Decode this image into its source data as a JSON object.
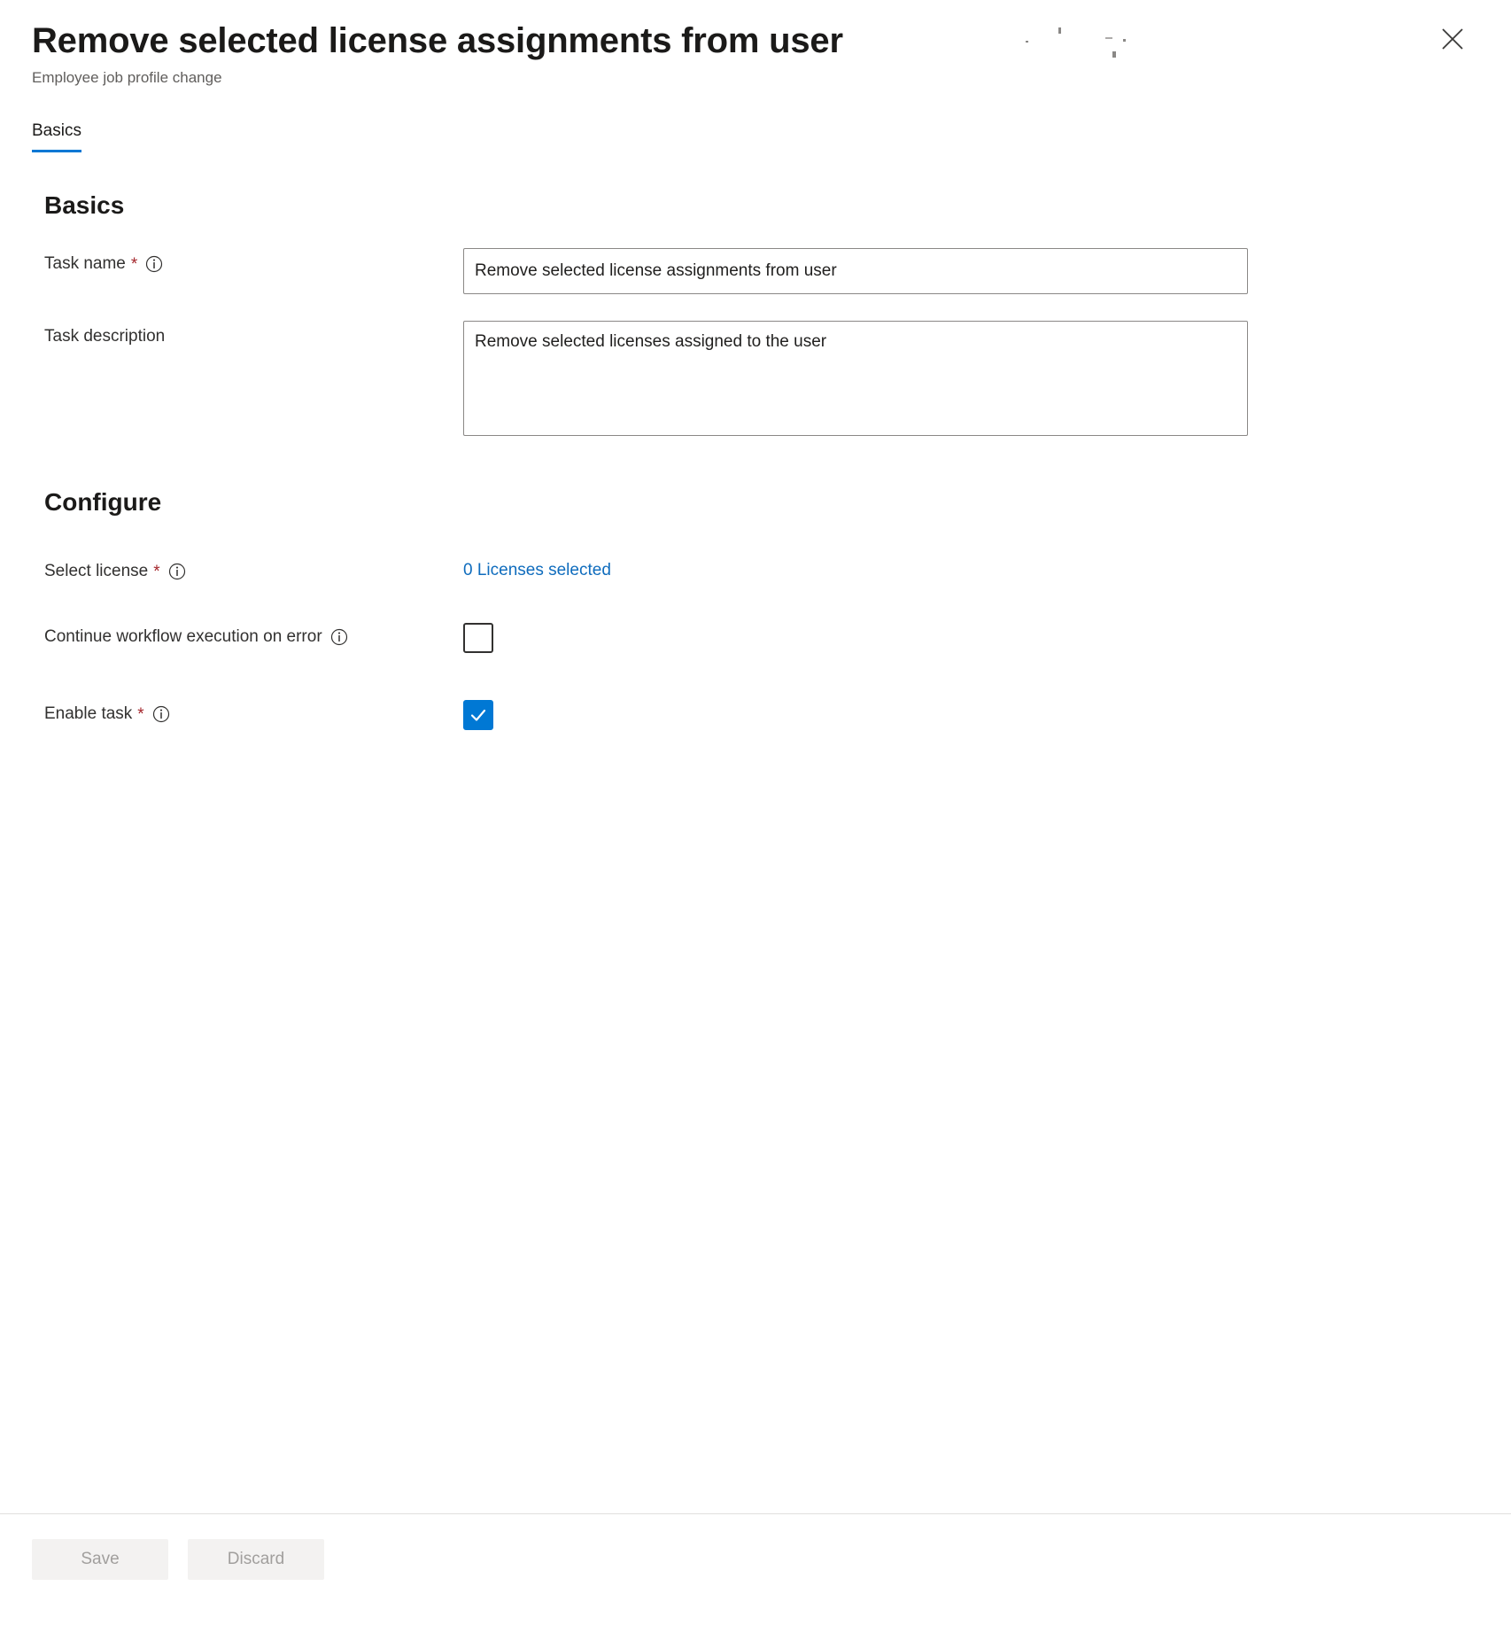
{
  "header": {
    "title": "Remove selected license assignments from user",
    "subtitle": "Employee job profile change",
    "close_label": "Close"
  },
  "tabs": [
    {
      "label": "Basics",
      "selected": true
    }
  ],
  "sections": {
    "basics": {
      "heading": "Basics",
      "task_name": {
        "label": "Task name",
        "required": "*",
        "value": "Remove selected license assignments from user",
        "placeholder": "Task name"
      },
      "task_description": {
        "label": "Task description",
        "value": "Remove selected licenses assigned to the user",
        "placeholder": "Task description"
      }
    },
    "configure": {
      "heading": "Configure",
      "select_license": {
        "label": "Select license",
        "required": "*",
        "link_text": "0 Licenses selected"
      },
      "continue_on_error": {
        "label": "Continue workflow execution on error",
        "checked": false
      },
      "enable_task": {
        "label": "Enable task",
        "required": "*",
        "checked": true
      }
    }
  },
  "footer": {
    "save_label": "Save",
    "discard_label": "Discard"
  },
  "colors": {
    "accent": "#0078d4",
    "link": "#0f6cbd",
    "required": "#a4262c",
    "disabled_button_bg": "#f3f2f1",
    "disabled_button_text": "#a19f9d"
  }
}
